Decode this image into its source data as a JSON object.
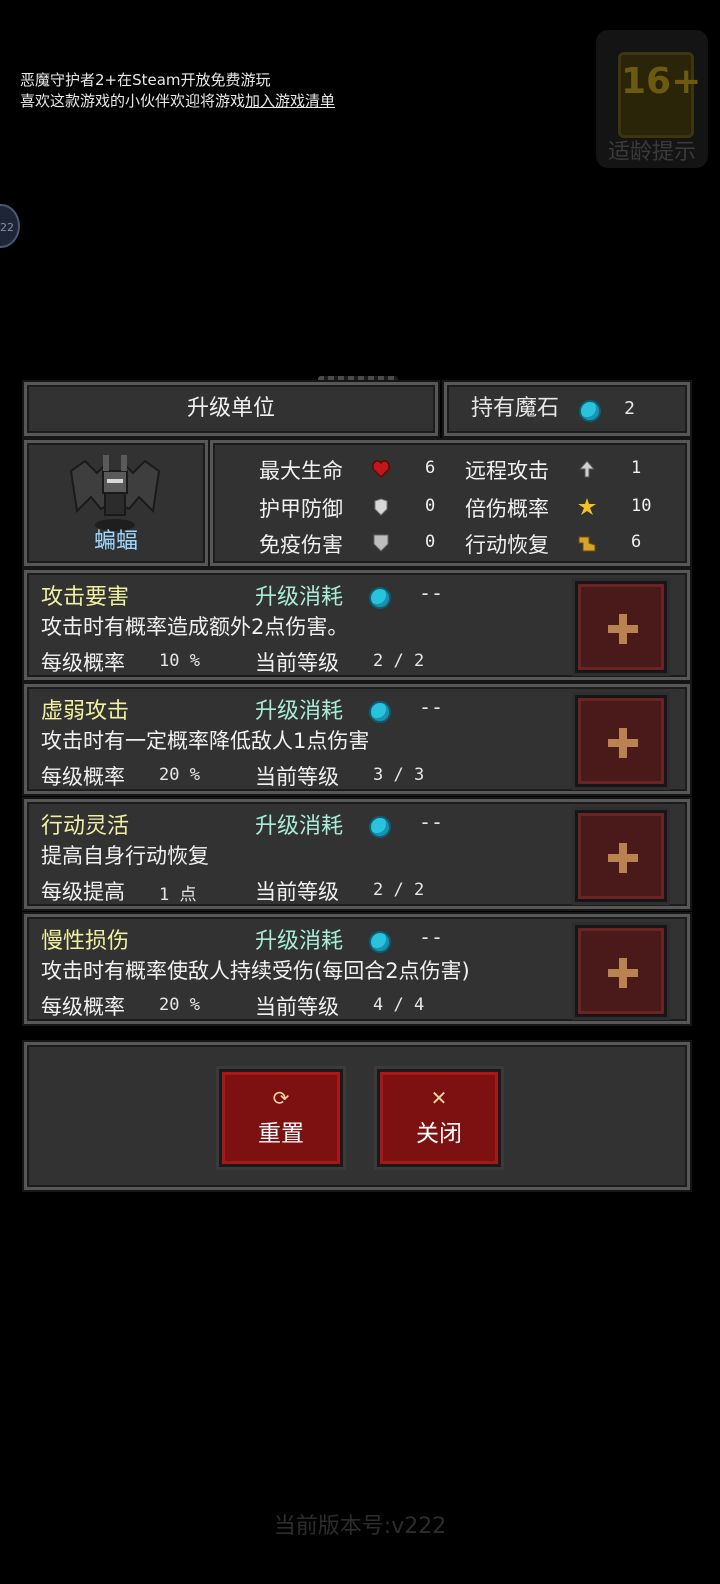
{
  "banner": {
    "line1": "恶魔守护者2+在Steam开放免费游玩",
    "line2_prefix": "喜欢这款游戏的小伙伴欢迎将游戏",
    "line2_link": "加入游戏清单"
  },
  "age_badge": {
    "rating": "16+",
    "caption": "适龄提示"
  },
  "side_badge": "22",
  "panel": {
    "title": "升级单位",
    "stone_label": "持有魔石",
    "stone_count": "2",
    "unit_name": "蝙蝠",
    "stats": [
      {
        "label": "最大生命",
        "icon": "heart-icon",
        "value": "6"
      },
      {
        "label": "远程攻击",
        "icon": "arrow-icon",
        "value": "1"
      },
      {
        "label": "护甲防御",
        "icon": "armor-icon",
        "value": "0"
      },
      {
        "label": "倍伤概率",
        "icon": "star-icon",
        "value": "10"
      },
      {
        "label": "免疫伤害",
        "icon": "shield-icon",
        "value": "0"
      },
      {
        "label": "行动恢复",
        "icon": "boot-icon",
        "value": "6"
      }
    ]
  },
  "skills": [
    {
      "name": "攻击要害",
      "cost_label": "升级消耗",
      "cost_value": "--",
      "desc": "攻击时有概率造成额外2点伤害。",
      "rate_label": "每级概率",
      "rate_value": "10 %",
      "level_label": "当前等级",
      "level_value": "2 / 2"
    },
    {
      "name": "虚弱攻击",
      "cost_label": "升级消耗",
      "cost_value": "--",
      "desc": "攻击时有一定概率降低敌人1点伤害",
      "rate_label": "每级概率",
      "rate_value": "20 %",
      "level_label": "当前等级",
      "level_value": "3 / 3"
    },
    {
      "name": "行动灵活",
      "cost_label": "升级消耗",
      "cost_value": "--",
      "desc": "提高自身行动恢复",
      "rate_label": "每级提高",
      "rate_value": "1 点",
      "level_label": "当前等级",
      "level_value": "2 / 2"
    },
    {
      "name": "慢性损伤",
      "cost_label": "升级消耗",
      "cost_value": "--",
      "desc": "攻击时有概率使敌人持续受伤(每回合2点伤害)",
      "rate_label": "每级概率",
      "rate_value": "20 %",
      "level_label": "当前等级",
      "level_value": "4 / 4"
    }
  ],
  "actions": {
    "reset": "重置",
    "close": "关闭"
  },
  "version": "当前版本号:v222",
  "colors": {
    "gem": "#2ac3dd",
    "button_red": "#7d1010",
    "panel_bg": "#323232",
    "skill_name": "#f0f0a0",
    "cost_label": "#a8ecd8",
    "unit_name": "#9ed9ff"
  }
}
